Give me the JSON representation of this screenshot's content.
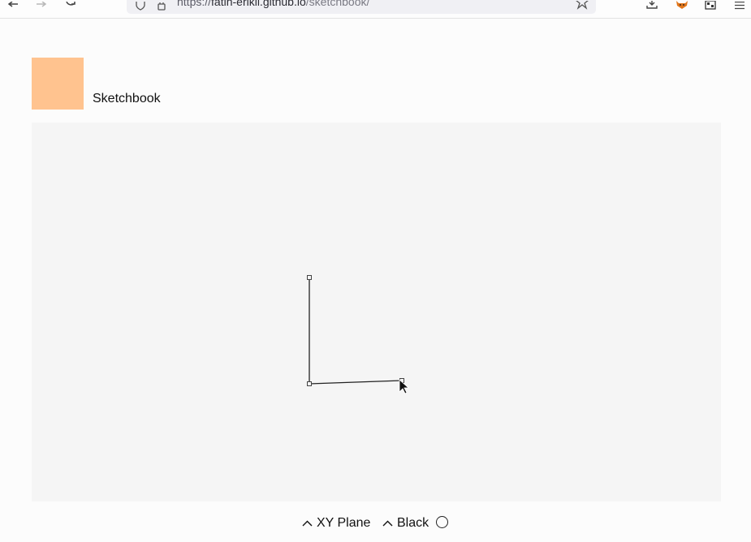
{
  "browser": {
    "url_prefix": "https://",
    "url_host": "fatih-erikli.github.io",
    "url_path": "/sketchbook/",
    "icons": [
      "back-arrow-icon",
      "forward-arrow-icon",
      "reload-icon",
      "shield-icon",
      "lock-icon",
      "bookmark-star-icon",
      "download-icon",
      "fox-extension-icon",
      "qr-extension-icon",
      "hamburger-menu-icon"
    ]
  },
  "app": {
    "title": "Sketchbook",
    "logo_color": "#ffc38f",
    "canvas_color": "#f5f5f5"
  },
  "bottom": {
    "plane_label": "XY Plane",
    "color_label": "Black",
    "caret_icon": "chevron-up-icon",
    "color_swatch": "circle-outline"
  },
  "sketch": {
    "segments": 2,
    "stroke_color": "#222222"
  }
}
